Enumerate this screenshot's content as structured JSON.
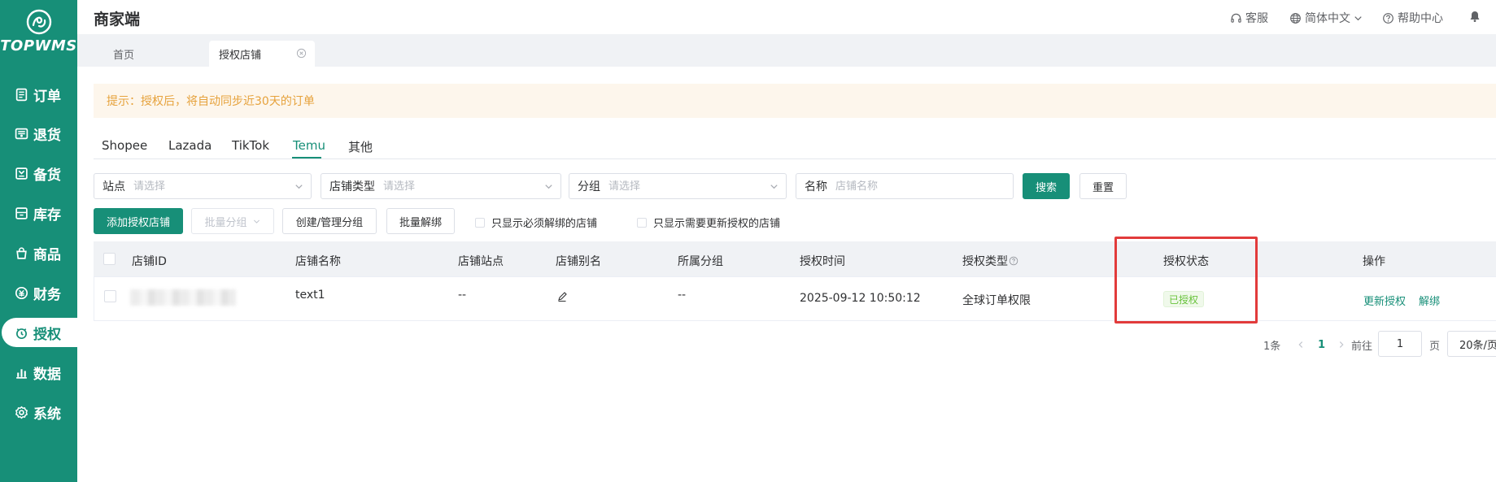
{
  "sidebar": {
    "brand": "TOPWMS",
    "items": [
      {
        "label": "订单",
        "icon": "order-icon"
      },
      {
        "label": "退货",
        "icon": "return-icon"
      },
      {
        "label": "备货",
        "icon": "stock-prep-icon"
      },
      {
        "label": "库存",
        "icon": "inventory-icon"
      },
      {
        "label": "商品",
        "icon": "product-icon"
      },
      {
        "label": "财务",
        "icon": "finance-icon"
      },
      {
        "label": "授权",
        "icon": "authorize-icon",
        "active": true
      },
      {
        "label": "数据",
        "icon": "data-icon"
      },
      {
        "label": "系统",
        "icon": "settings-icon"
      }
    ]
  },
  "header": {
    "title": "商家端",
    "support": "客服",
    "language": "简体中文",
    "help": "帮助中心"
  },
  "page_tabs": {
    "home": "首页",
    "current": "授权店铺"
  },
  "notice": "提示：授权后，将自动同步近30天的订单",
  "platform_tabs": {
    "items": [
      "Shopee",
      "Lazada",
      "TikTok",
      "Temu",
      "其他"
    ],
    "active": "Temu"
  },
  "filters": {
    "site_label": "站点",
    "site_placeholder": "请选择",
    "shop_type_label": "店铺类型",
    "shop_type_placeholder": "请选择",
    "group_label": "分组",
    "group_placeholder": "请选择",
    "name_label": "名称",
    "name_placeholder": "店铺名称",
    "search": "搜索",
    "reset": "重置"
  },
  "actions": {
    "add_shop": "添加授权店铺",
    "batch_group": "批量分组",
    "manage_group": "创建/管理分组",
    "batch_unbind": "批量解绑",
    "only_must_unbind": "只显示必须解绑的店铺",
    "only_need_reauth": "只显示需要更新授权的店铺"
  },
  "table": {
    "columns": [
      "店铺ID",
      "店铺名称",
      "店铺站点",
      "店铺别名",
      "所属分组",
      "授权时间",
      "授权类型",
      "授权状态",
      "操作"
    ],
    "rows": [
      {
        "shop_name": "text1",
        "site": "--",
        "group": "--",
        "auth_time": "2025-09-12 10:50:12",
        "auth_type": "全球订单权限",
        "status": "已授权",
        "action_update": "更新授权",
        "action_unbind": "解绑"
      }
    ]
  },
  "pagination": {
    "total": "1条",
    "current": "1",
    "goto_label": "前往",
    "goto_value": "1",
    "page_suffix": "页",
    "page_size": "20条/页"
  },
  "colors": {
    "brand": "#178f78",
    "notice_text": "#e6a23c",
    "success": "#67c23a",
    "highlight": "#e23b3b"
  }
}
